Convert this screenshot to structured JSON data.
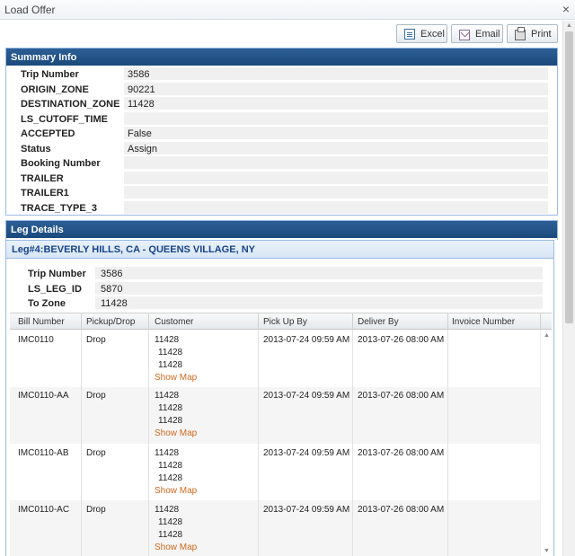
{
  "window": {
    "title": "Load Offer",
    "close_glyph": "×"
  },
  "toolbar": {
    "excel_label": "Excel",
    "email_label": "Email",
    "print_label": "Print"
  },
  "summary": {
    "title": "Summary Info",
    "fields": [
      {
        "label": "Trip Number",
        "value": "3586"
      },
      {
        "label": "ORIGIN_ZONE",
        "value": "90221"
      },
      {
        "label": "DESTINATION_ZONE",
        "value": "11428"
      },
      {
        "label": "LS_CUTOFF_TIME",
        "value": ""
      },
      {
        "label": "ACCEPTED",
        "value": "False"
      },
      {
        "label": "Status",
        "value": "Assign"
      },
      {
        "label": "Booking Number",
        "value": ""
      },
      {
        "label": "TRAILER",
        "value": ""
      },
      {
        "label": "TRAILER1",
        "value": ""
      },
      {
        "label": "TRACE_TYPE_3",
        "value": ""
      }
    ]
  },
  "leg_details": {
    "title": "Leg Details",
    "leg_title": "Leg#4:BEVERLY HILLS, CA - QUEENS VILLAGE, NY",
    "fields": [
      {
        "label": "Trip Number",
        "value": "3586"
      },
      {
        "label": "LS_LEG_ID",
        "value": "5870"
      },
      {
        "label": "To Zone",
        "value": "11428"
      }
    ],
    "columns": [
      "Bill Number",
      "Pickup/Drop",
      "Customer",
      "Pick Up By",
      "Deliver By",
      "Invoice Number"
    ],
    "rows": [
      {
        "bill": "IMC0110",
        "pd": "Drop",
        "cust1": "11428",
        "cust2": "11428",
        "cust3": "11428",
        "map": "Show Map",
        "pickup": "2013-07-24 09:59 AM",
        "deliver": "2013-07-26 08:00 AM",
        "invoice": ""
      },
      {
        "bill": "IMC0110-AA",
        "pd": "Drop",
        "cust1": "11428",
        "cust2": "11428",
        "cust3": "11428",
        "map": "Show Map",
        "pickup": "2013-07-24 09:59 AM",
        "deliver": "2013-07-26 08:00 AM",
        "invoice": ""
      },
      {
        "bill": "IMC0110-AB",
        "pd": "Drop",
        "cust1": "11428",
        "cust2": "11428",
        "cust3": "11428",
        "map": "Show Map",
        "pickup": "2013-07-24 09:59 AM",
        "deliver": "2013-07-26 08:00 AM",
        "invoice": ""
      },
      {
        "bill": "IMC0110-AC",
        "pd": "Drop",
        "cust1": "11428",
        "cust2": "11428",
        "cust3": "11428",
        "map": "Show Map",
        "pickup": "2013-07-24 09:59 AM",
        "deliver": "2013-07-26 08:00 AM",
        "invoice": ""
      }
    ]
  },
  "icons": {
    "excel": "excel-icon",
    "email": "email-icon",
    "print": "print-icon",
    "close": "close-icon"
  }
}
